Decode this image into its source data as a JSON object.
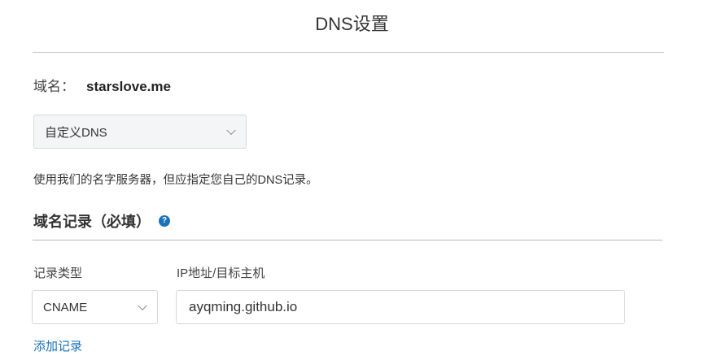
{
  "page": {
    "title": "DNS设置"
  },
  "domain": {
    "label": "域名：",
    "value": "starslove.me"
  },
  "dns_select": {
    "selected": "自定义DNS"
  },
  "description": "使用我们的名字服务器，但应指定您自己的DNS记录。",
  "records_section": {
    "title": "域名记录（必填）",
    "help_icon": "question-circle-icon"
  },
  "record_form": {
    "type_label": "记录类型",
    "target_label": "IP地址/目标主机",
    "type_value": "CNAME",
    "target_value": "ayqming.github.io"
  },
  "add_record_label": "添加记录",
  "colors": {
    "link": "#1a73b8",
    "select_bg": "#f4f5f7",
    "divider": "#c9c9d3"
  }
}
